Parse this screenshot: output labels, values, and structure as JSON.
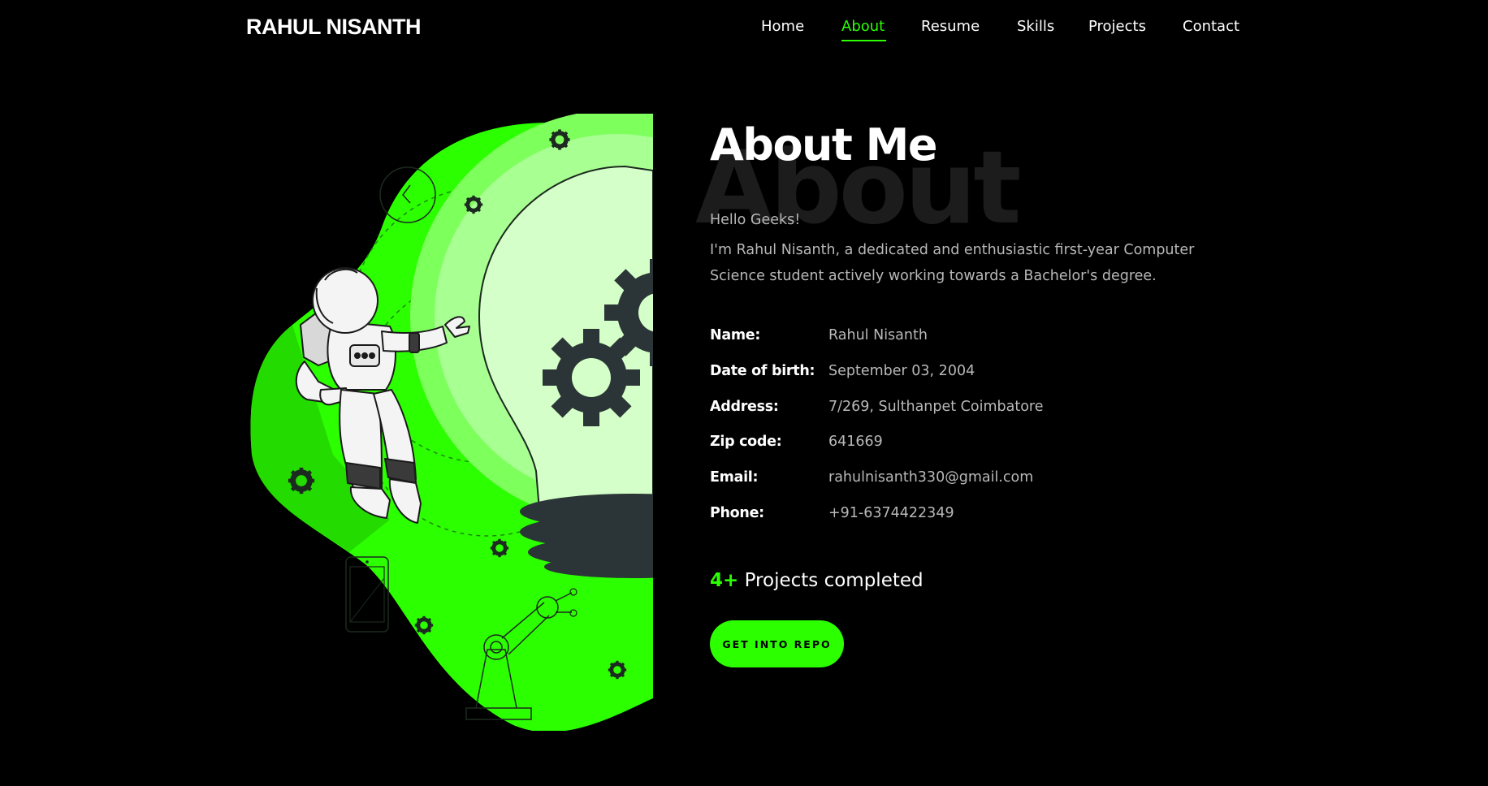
{
  "brand": "RAHUL NISANTH",
  "nav": {
    "items": [
      "Home",
      "About",
      "Resume",
      "Skills",
      "Projects",
      "Contact"
    ],
    "active": "About"
  },
  "colors": {
    "accent": "#2bff00",
    "background": "#000000"
  },
  "about": {
    "heading": "About Me",
    "heading_bg": "About",
    "greeting": "Hello Geeks!",
    "intro": "I'm Rahul Nisanth, a dedicated and enthusiastic first-year Computer Science student actively working towards a Bachelor's degree.",
    "info": [
      {
        "label": "Name:",
        "value": "Rahul Nisanth"
      },
      {
        "label": "Date of birth:",
        "value": "September 03, 2004"
      },
      {
        "label": "Address:",
        "value": "7/269, Sulthanpet Coimbatore"
      },
      {
        "label": "Zip code:",
        "value": "641669"
      },
      {
        "label": "Email:",
        "value": "rahulnisanth330@gmail.com"
      },
      {
        "label": "Phone:",
        "value": "+91-6374422349"
      }
    ],
    "projects_count": "4+",
    "projects_text": "Projects completed",
    "button_label": "GET INTO REPO"
  }
}
